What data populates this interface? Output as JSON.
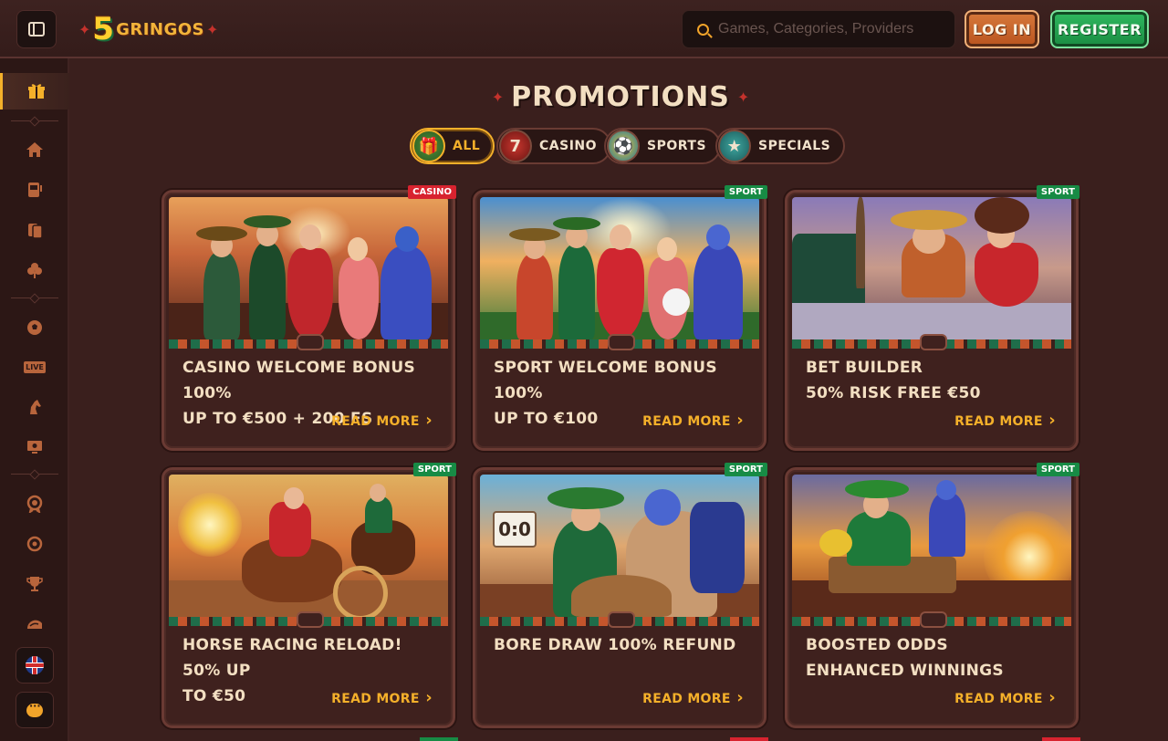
{
  "header": {
    "logo_number": "5",
    "logo_word": "GRINGOS",
    "search_placeholder": "Games, Categories, Providers",
    "login_label": "LOG IN",
    "register_label": "REGISTER"
  },
  "sidebar": {
    "items": [
      {
        "name": "promotions",
        "icon": "gift-icon",
        "glyph": "🎁",
        "active": true
      },
      {
        "name": "home",
        "icon": "home-icon",
        "glyph": "⌂"
      },
      {
        "name": "slots",
        "icon": "slot-machine-icon",
        "glyph": "▤"
      },
      {
        "name": "cards",
        "icon": "cards-icon",
        "glyph": "♠"
      },
      {
        "name": "lucky",
        "icon": "clover-icon",
        "glyph": "♣"
      },
      {
        "name": "sports",
        "icon": "soccer-ball-icon",
        "glyph": "⚽"
      },
      {
        "name": "live",
        "icon": "live-icon",
        "glyph": "LIVE"
      },
      {
        "name": "horse-racing",
        "icon": "horse-icon",
        "glyph": "♞"
      },
      {
        "name": "virtual",
        "icon": "monitor-icon",
        "glyph": "▭"
      },
      {
        "name": "achievements",
        "icon": "badge-icon",
        "glyph": "✪"
      },
      {
        "name": "missions",
        "icon": "target-icon",
        "glyph": "◎"
      },
      {
        "name": "tournaments",
        "icon": "trophy-icon",
        "glyph": "🏆"
      },
      {
        "name": "shop",
        "icon": "taco-icon",
        "glyph": "◗"
      }
    ]
  },
  "main": {
    "title": "PROMOTIONS",
    "filters": [
      {
        "label": "ALL",
        "active": true
      },
      {
        "label": "CASINO"
      },
      {
        "label": "SPORTS"
      },
      {
        "label": "SPECIALS"
      }
    ],
    "cards": [
      {
        "tag": "CASINO",
        "title_line1": "CASINO WELCOME BONUS 100%",
        "title_line2": "UP TO €500 + 200 FS",
        "read_more": "READ MORE"
      },
      {
        "tag": "SPORT",
        "title_line1": "SPORT WELCOME BONUS 100%",
        "title_line2": "UP TO €100",
        "read_more": "READ MORE"
      },
      {
        "tag": "SPORT",
        "title_line1": "BET BUILDER",
        "title_line2": "50% RISK FREE €50",
        "read_more": "READ MORE"
      },
      {
        "tag": "SPORT",
        "title_line1": "HORSE RACING RELOAD! 50% UP",
        "title_line2": "TO €50",
        "read_more": "READ MORE"
      },
      {
        "tag": "SPORT",
        "title_line1": "BORE DRAW 100% REFUND",
        "title_line2": "",
        "read_more": "READ MORE"
      },
      {
        "tag": "SPORT",
        "title_line1": "BOOSTED ODDS",
        "title_line2": "ENHANCED WINNINGS",
        "read_more": "READ MORE"
      }
    ],
    "scoreboard_text": "0:0"
  },
  "colors": {
    "background": "#3a1f1d",
    "accent_gold": "#f4b02a",
    "register_green": "#1b8c42",
    "login_orange": "#b9541f",
    "casino_tag": "#d8232f",
    "sport_tag": "#178b45"
  }
}
